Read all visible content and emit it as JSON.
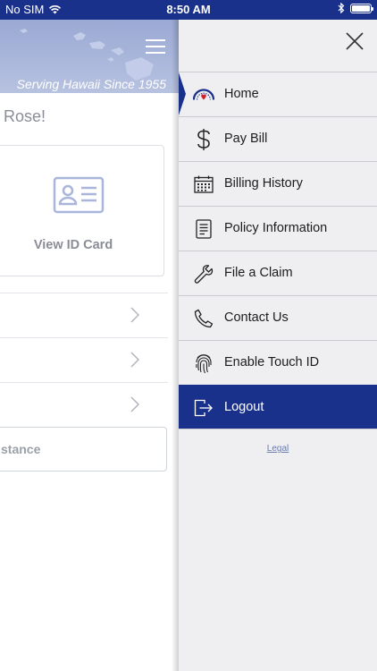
{
  "status_bar": {
    "carrier": "No SIM",
    "time": "8:50 AM"
  },
  "background_page": {
    "tagline": "Serving Hawaii Since 1955",
    "greeting": "Rose!",
    "id_card_label": "View ID Card",
    "assistance_label": "stance"
  },
  "drawer": {
    "menu": [
      {
        "label": "Home",
        "icon": "hawaii-logo-icon",
        "active": true
      },
      {
        "label": "Pay Bill",
        "icon": "dollar-icon"
      },
      {
        "label": "Billing History",
        "icon": "calendar-icon"
      },
      {
        "label": "Policy Information",
        "icon": "document-icon"
      },
      {
        "label": "File a Claim",
        "icon": "wrench-icon"
      },
      {
        "label": "Contact Us",
        "icon": "phone-icon"
      },
      {
        "label": "Enable Touch ID",
        "icon": "fingerprint-icon"
      },
      {
        "label": "Logout",
        "icon": "logout-icon"
      }
    ],
    "legal": "Legal"
  },
  "colors": {
    "brand_blue": "#1a318c",
    "drawer_bg": "#efeff1",
    "banner": "#a9b5da"
  }
}
